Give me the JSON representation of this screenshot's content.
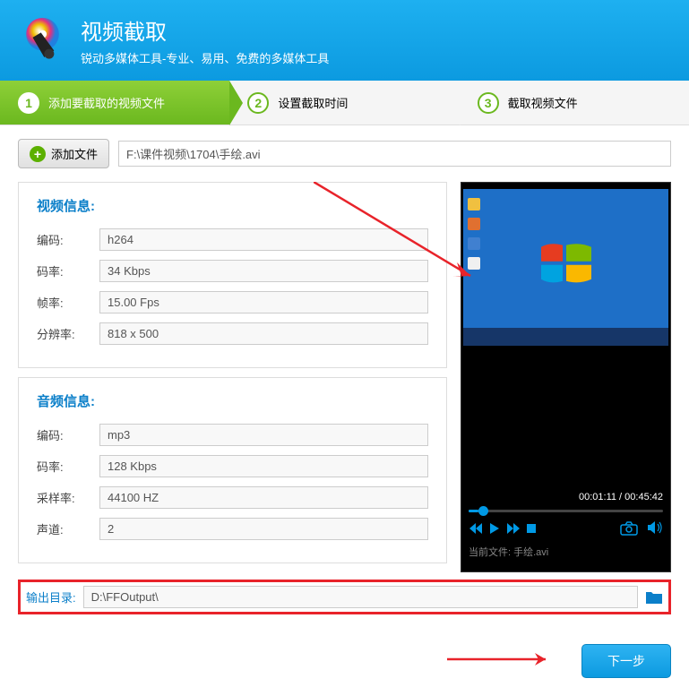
{
  "header": {
    "title": "视频截取",
    "subtitle": "锐动多媒体工具-专业、易用、免费的多媒体工具"
  },
  "steps": [
    {
      "num": "1",
      "label": "添加要截取的视频文件"
    },
    {
      "num": "2",
      "label": "设置截取时间"
    },
    {
      "num": "3",
      "label": "截取视频文件"
    }
  ],
  "toolbar": {
    "add_label": "添加文件",
    "path": "F:\\课件视频\\1704\\手绘.avi"
  },
  "video_info": {
    "title": "视频信息:",
    "rows": [
      {
        "label": "编码:",
        "value": "h264"
      },
      {
        "label": "码率:",
        "value": "34 Kbps"
      },
      {
        "label": "帧率:",
        "value": "15.00 Fps"
      },
      {
        "label": "分辨率:",
        "value": "818 x 500"
      }
    ]
  },
  "audio_info": {
    "title": "音频信息:",
    "rows": [
      {
        "label": "编码:",
        "value": "mp3"
      },
      {
        "label": "码率:",
        "value": "128 Kbps"
      },
      {
        "label": "采样率:",
        "value": "44100 HZ"
      },
      {
        "label": "声道:",
        "value": "2"
      }
    ]
  },
  "player": {
    "time": "00:01:11 / 00:45:42",
    "current_file_label": "当前文件:",
    "current_file": "手绘.avi"
  },
  "output": {
    "label": "输出目录:",
    "path": "D:\\FFOutput\\"
  },
  "footer": {
    "next_label": "下一步"
  }
}
